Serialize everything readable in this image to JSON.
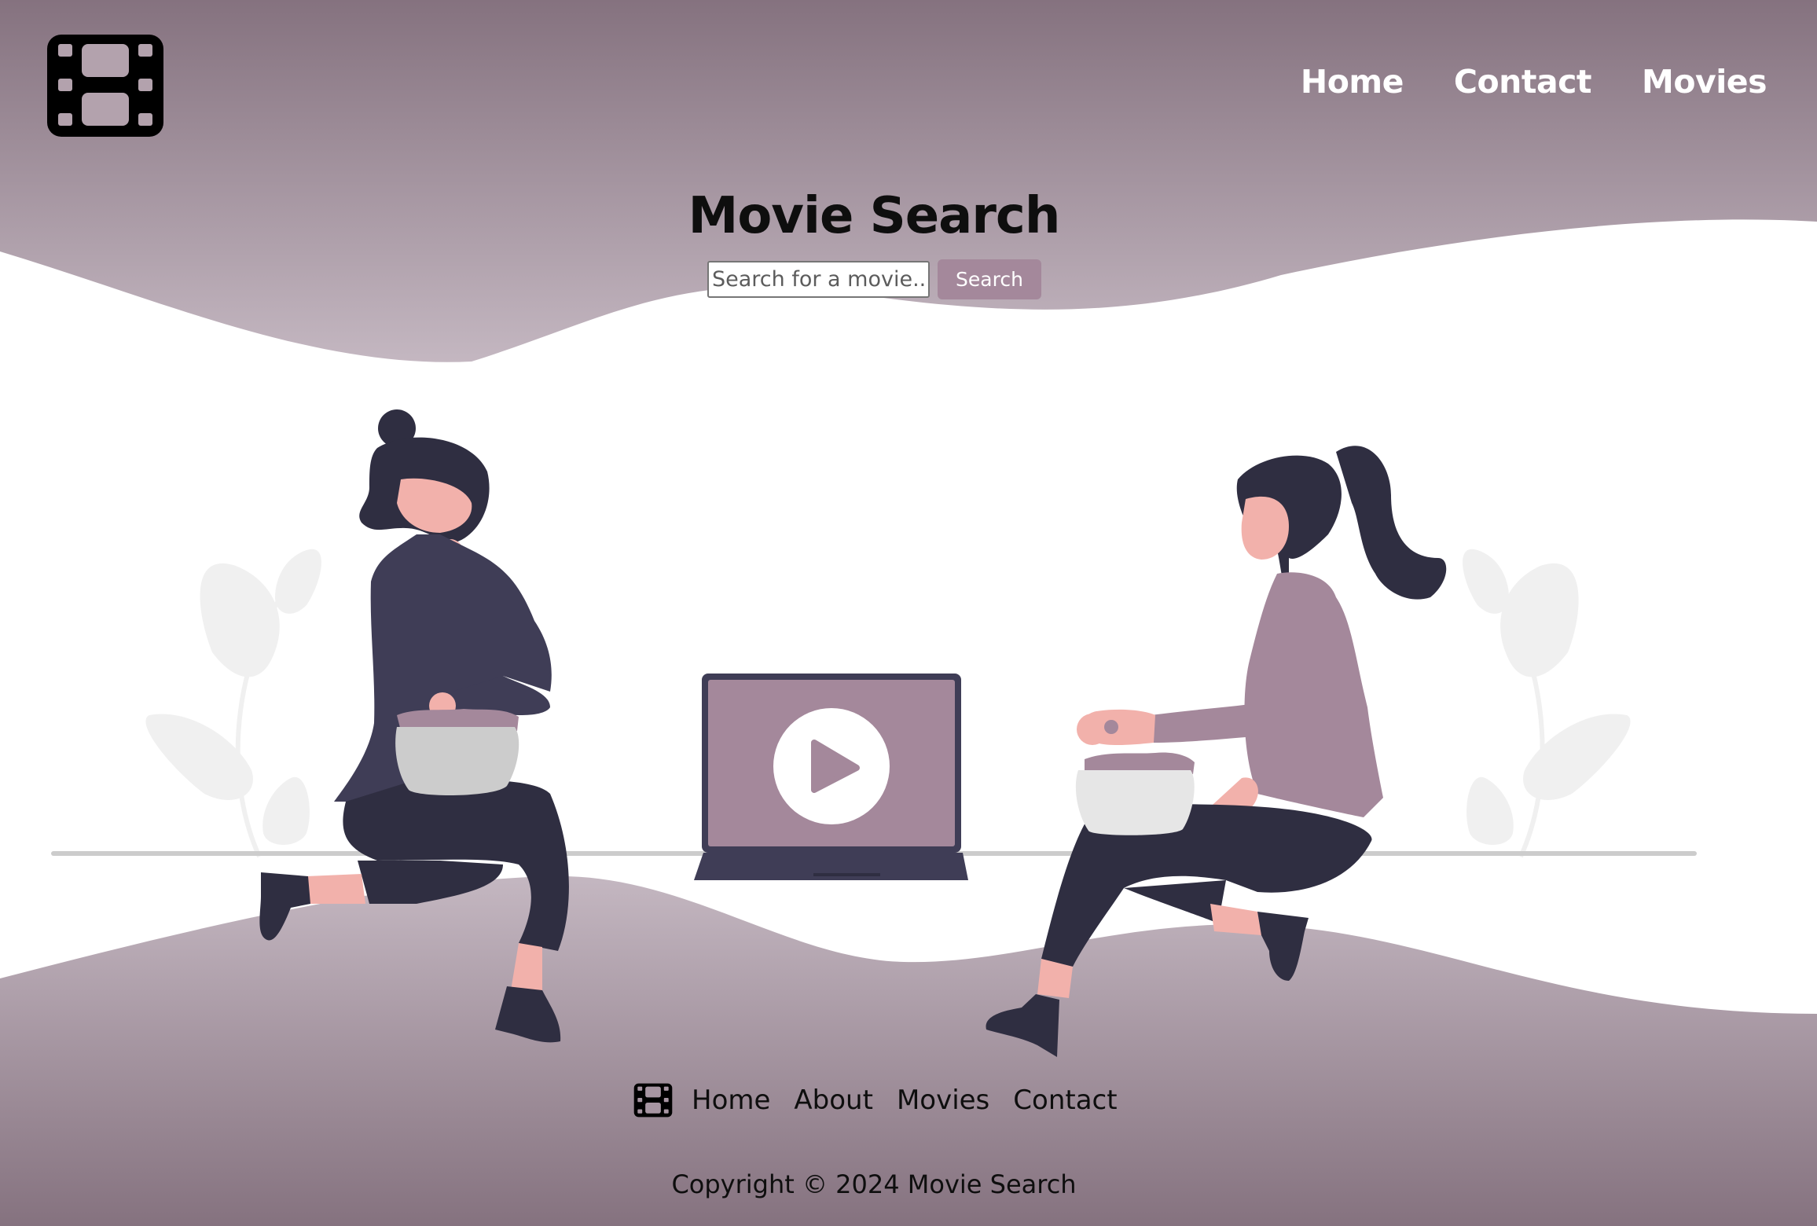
{
  "brand": {
    "logo_icon": "film-strip-icon"
  },
  "nav": {
    "items": [
      "Home",
      "Contact",
      "Movies"
    ]
  },
  "hero": {
    "title": "Movie Search"
  },
  "search": {
    "placeholder": "Search for a movie...",
    "button_label": "Search"
  },
  "illustration": {
    "center_icon": "play-icon",
    "subject": "two-women-eating-popcorn-watching-laptop"
  },
  "footer": {
    "logo_icon": "film-strip-icon",
    "links": [
      "Home",
      "About",
      "Movies",
      "Contact"
    ],
    "copyright": "Copyright © 2024 Movie Search"
  },
  "colors": {
    "band_top": "#85727f",
    "band_light": "#c4b7c1",
    "accent": "#a4889b",
    "dark_clothing": "#2f2e41",
    "sweater": "#3f3d56",
    "skin": "#f2b1ab",
    "foliage": "#f0f0f0"
  }
}
